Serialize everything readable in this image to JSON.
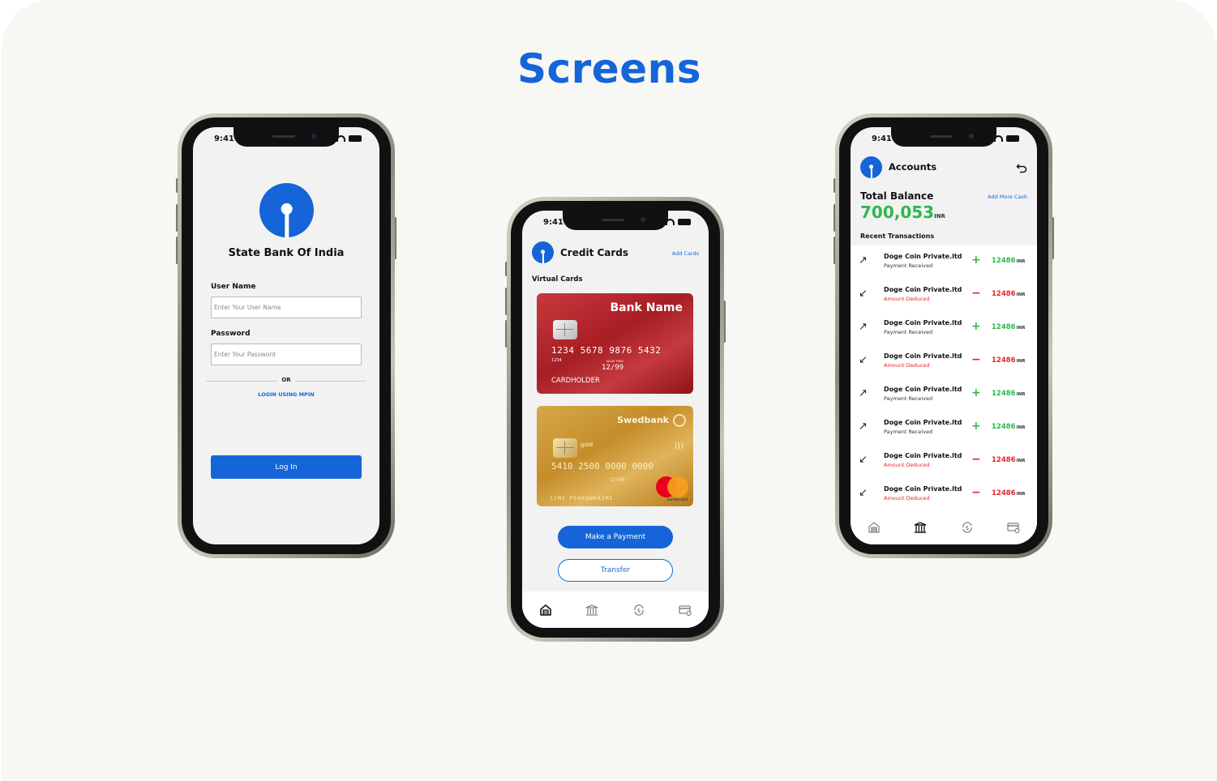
{
  "page": {
    "title": "Screens",
    "accent": "#1565d8",
    "positive": "#2db84d",
    "negative": "#e8232e"
  },
  "status": {
    "time": "9:41"
  },
  "login": {
    "bank_name": "State Bank Of India",
    "username_label": "User Name",
    "username_placeholder": "Enter Your User Name",
    "password_label": "Password",
    "password_placeholder": "Enter Your Password",
    "or_label": "OR",
    "mpin_link": "LOGIN USING MPIN",
    "login_button": "Log In"
  },
  "cards": {
    "title": "Credit Cards",
    "add_link": "Add Cards",
    "section": "Virtual Cards",
    "card1": {
      "bank": "Bank Name",
      "number": "1234  5678  9876  5432",
      "small": "1234",
      "valid_label": "VALID THRU",
      "valid": "12/99",
      "holder": "CARDHOLDER"
    },
    "card2": {
      "bank": "Swedbank",
      "tier": "gold",
      "number": "5410  2500  0000  0000",
      "valid": "12/99",
      "holder": "IIMI PERKONNAIMI",
      "network": "mastercard"
    },
    "pay_button": "Make a Payment",
    "transfer_button": "Transfer"
  },
  "accounts": {
    "title": "Accounts",
    "balance_label": "Total Balance",
    "add_link": "Add More Cash",
    "balance": "700,053",
    "currency": "INR",
    "recent_label": "Recent Transactions",
    "transactions": [
      {
        "name": "Doge Coin Private.ltd",
        "note": "Payment Received",
        "sign": "+",
        "amount": "12486",
        "type": "in"
      },
      {
        "name": "Doge Coin Private.ltd",
        "note": "Amount Deduced",
        "sign": "−",
        "amount": "12486",
        "type": "out"
      },
      {
        "name": "Doge Coin Private.ltd",
        "note": "Payment Received",
        "sign": "+",
        "amount": "12486",
        "type": "in"
      },
      {
        "name": "Doge Coin Private.ltd",
        "note": "Amount Deduced",
        "sign": "−",
        "amount": "12486",
        "type": "out"
      },
      {
        "name": "Doge Coin Private.ltd",
        "note": "Payment Received",
        "sign": "+",
        "amount": "12486",
        "type": "in"
      },
      {
        "name": "Doge Coin Private.ltd",
        "note": "Payment Received",
        "sign": "+",
        "amount": "12486",
        "type": "in"
      },
      {
        "name": "Doge Coin Private.ltd",
        "note": "Amount Deduced",
        "sign": "−",
        "amount": "12486",
        "type": "out"
      },
      {
        "name": "Doge Coin Private.ltd",
        "note": "Amount Deduced",
        "sign": "−",
        "amount": "12486",
        "type": "out"
      }
    ]
  },
  "nav_icons": [
    "home-icon",
    "bank-icon",
    "exchange-icon",
    "card-icon"
  ]
}
